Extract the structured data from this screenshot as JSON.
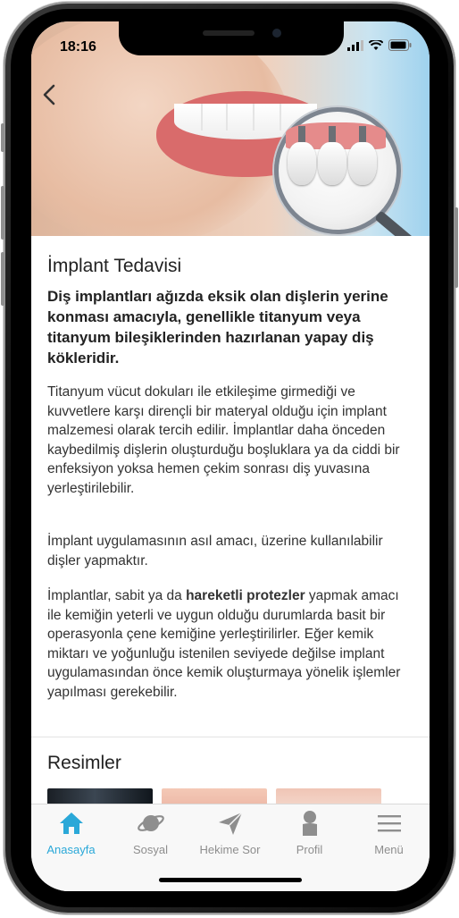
{
  "status": {
    "time": "18:16"
  },
  "article": {
    "title": "İmplant Tedavisi",
    "lead": "Diş implantları ağızda eksik olan dişlerin yerine konması amacıyla, genellikle titanyum veya titanyum bileşiklerinden hazırlanan yapay diş kökleridir.",
    "p1": "Titanyum vücut dokuları ile etkileşime girmediği ve kuvvetlere karşı dirençli bir materyal olduğu için implant malzemesi olarak tercih edilir. İmplantlar daha önceden kaybedilmiş dişlerin oluşturduğu boşluklara ya da ciddi bir enfeksiyon yoksa hemen çekim sonrası diş yuvasına yerleştirilebilir.",
    "p2": "İmplant uygulamasının asıl amacı, üzerine kullanılabilir dişler yapmaktır.",
    "p3_before": "İmplantlar, sabit ya da ",
    "p3_bold": "hareketli protezler",
    "p3_after": " yapmak amacı ile kemiğin yeterli ve uygun olduğu durumlarda basit bir operasyonla çene kemiğine yerleştirilirler. Eğer kemik miktarı ve yoğunluğu istenilen seviyede değilse implant uygulamasından önce kemik oluşturmaya yönelik işlemler yapılması gerekebilir."
  },
  "gallery": {
    "title": "Resimler"
  },
  "tabs": [
    {
      "label": "Anasayfa",
      "icon": "home-icon",
      "active": true
    },
    {
      "label": "Sosyal",
      "icon": "planet-icon",
      "active": false
    },
    {
      "label": "Hekime Sor",
      "icon": "paper-plane-icon",
      "active": false
    },
    {
      "label": "Profil",
      "icon": "person-icon",
      "active": false
    },
    {
      "label": "Menü",
      "icon": "hamburger-icon",
      "active": false
    }
  ],
  "colors": {
    "accent": "#2aa8d8",
    "inactive": "#8e8e8e"
  }
}
